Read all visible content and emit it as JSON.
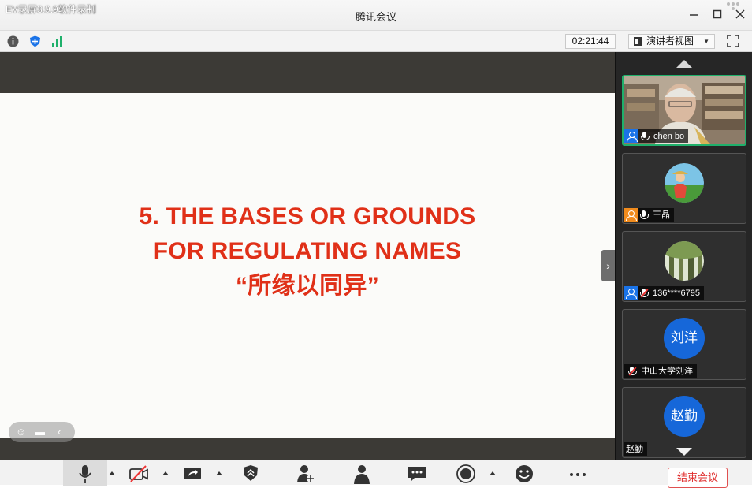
{
  "recording_label": "EV录屏3.9.9软件录制",
  "window": {
    "title": "腾讯会议"
  },
  "toolbar": {
    "timer": "02:21:44",
    "view_label": "演讲者视图"
  },
  "slide": {
    "line1": "5. THE BASES OR GROUNDS",
    "line2": "FOR REGULATING NAMES",
    "line3": "“所缘以同异”"
  },
  "participants": [
    {
      "name": "chen bo",
      "role": "host",
      "mic": "on"
    },
    {
      "name": "王晶",
      "role": "cohost",
      "mic": "on"
    },
    {
      "name": "136****6795",
      "role": "host-blue",
      "mic": "muted"
    },
    {
      "name": "中山大学刘洋",
      "avatar_text": "刘洋",
      "mic": "muted"
    },
    {
      "name": "赵勤",
      "avatar_text": "赵勤"
    }
  ],
  "bottombar": {
    "end_meeting_label": "结束会议"
  },
  "colors": {
    "slide_title": "#e03018",
    "host_badge": "#1a73e8",
    "cohost_badge": "#f08b1d",
    "active_border": "#1fb06b",
    "avatar_bg": "#1667d9"
  },
  "icons": [
    "info-icon",
    "shield-icon",
    "signal-icon",
    "speaker-view-icon",
    "fullscreen-icon",
    "minimize-icon",
    "maximize-icon",
    "close-icon",
    "mic-icon",
    "camera-off-icon",
    "share-screen-icon",
    "security-icon",
    "participants-icon",
    "chat-icon",
    "record-icon",
    "reaction-icon",
    "more-icon"
  ]
}
